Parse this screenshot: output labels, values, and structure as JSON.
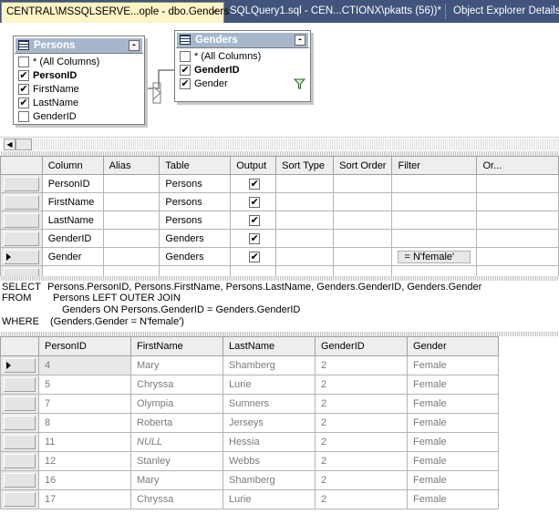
{
  "tabs": {
    "active": "CENTRAL\\MSSQLSERVE...ople - dbo.Genders",
    "active_close": "×",
    "second": "SQLQuery1.sql - CEN...CTIONX\\pkatts (56))*",
    "third": "Object Explorer Details"
  },
  "diagram": {
    "persons": {
      "title": "Persons",
      "minimize": "-",
      "fields": [
        {
          "label": "* (All Columns)",
          "checked": "",
          "bold": false
        },
        {
          "label": "PersonID",
          "checked": "✔",
          "bold": true
        },
        {
          "label": "FirstName",
          "checked": "✔",
          "bold": false
        },
        {
          "label": "LastName",
          "checked": "✔",
          "bold": false
        },
        {
          "label": "GenderID",
          "checked": "",
          "bold": false
        }
      ]
    },
    "genders": {
      "title": "Genders",
      "minimize": "-",
      "fields": [
        {
          "label": "* (All Columns)",
          "checked": "",
          "bold": false
        },
        {
          "label": "GenderID",
          "checked": "✔",
          "bold": true
        },
        {
          "label": "Gender",
          "checked": "✔",
          "bold": false
        }
      ],
      "filter_icon": "funnel-icon"
    }
  },
  "scroll": {
    "left_arrow": "◀"
  },
  "criteria": {
    "headers": [
      "Column",
      "Alias",
      "Table",
      "Output",
      "Sort Type",
      "Sort Order",
      "Filter",
      "Or..."
    ],
    "rows": [
      {
        "column": "PersonID",
        "alias": "",
        "table": "Persons",
        "output": "✔",
        "sort_type": "",
        "sort_order": "",
        "filter": "",
        "current": false
      },
      {
        "column": "FirstName",
        "alias": "",
        "table": "Persons",
        "output": "✔",
        "sort_type": "",
        "sort_order": "",
        "filter": "",
        "current": false
      },
      {
        "column": "LastName",
        "alias": "",
        "table": "Persons",
        "output": "✔",
        "sort_type": "",
        "sort_order": "",
        "filter": "",
        "current": false
      },
      {
        "column": "GenderID",
        "alias": "",
        "table": "Genders",
        "output": "✔",
        "sort_type": "",
        "sort_order": "",
        "filter": "",
        "current": false
      },
      {
        "column": "Gender",
        "alias": "",
        "table": "Genders",
        "output": "✔",
        "sort_type": "",
        "sort_order": "",
        "filter": "= N'female'",
        "current": true
      }
    ]
  },
  "sql": {
    "lines": [
      {
        "kw": "SELECT",
        "text": "Persons.PersonID, Persons.FirstName, Persons.LastName, Genders.GenderID, Genders.Gender"
      },
      {
        "kw": "FROM",
        "text": "Persons LEFT OUTER JOIN"
      },
      {
        "kw": "",
        "text": "Genders ON Persons.GenderID = Genders.GenderID"
      },
      {
        "kw": "WHERE",
        "text": "(Genders.Gender = N'female')"
      }
    ]
  },
  "results": {
    "headers": [
      "PersonID",
      "FirstName",
      "LastName",
      "GenderID",
      "Gender"
    ],
    "rows": [
      [
        "4",
        "Mary",
        "Shamberg",
        "2",
        "Female"
      ],
      [
        "5",
        "Chryssa",
        "Lurie",
        "2",
        "Female"
      ],
      [
        "7",
        "Olympia",
        "Sumners",
        "2",
        "Female"
      ],
      [
        "8",
        "Roberta",
        "Jerseys",
        "2",
        "Female"
      ],
      [
        "11",
        "NULL",
        "Hessia",
        "2",
        "Female"
      ],
      [
        "12",
        "Stanley",
        "Webbs",
        "2",
        "Female"
      ],
      [
        "16",
        "Mary",
        "Shamberg",
        "2",
        "Female"
      ],
      [
        "17",
        "Chryssa",
        "Lurie",
        "2",
        "Female"
      ]
    ]
  }
}
